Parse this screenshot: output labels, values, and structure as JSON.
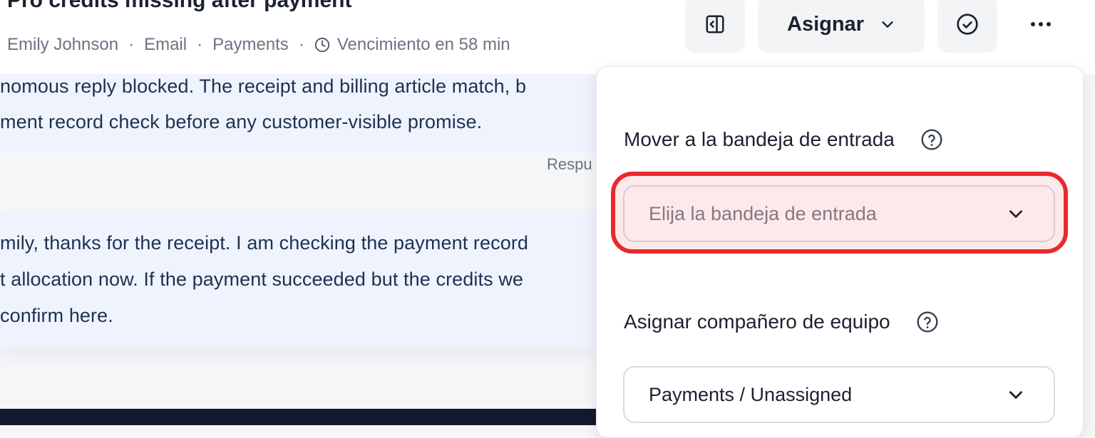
{
  "ticket": {
    "title": "Pro credits missing after payment",
    "customer": "Emily Johnson",
    "channel": "Email",
    "team": "Payments",
    "due": "Vencimiento en 58 min"
  },
  "toolbar": {
    "assign_label": "Asignar"
  },
  "thread": {
    "note_line1": "nomous reply blocked. The receipt and billing article match, b",
    "note_line2": "ment record check before any customer-visible promise.",
    "respu_label": "Respu",
    "reply_line1": "mily, thanks for the receipt. I am checking the payment record",
    "reply_line2": "t allocation now. If the payment succeeded but the credits we",
    "reply_line3": "confirm here."
  },
  "assign_panel": {
    "inbox_label": "Mover a la bandeja de entrada",
    "inbox_placeholder": "Elija la bandeja de entrada",
    "teammate_label": "Asignar compañero de equipo",
    "teammate_value": "Payments / Unassigned"
  },
  "colors": {
    "highlight": "#e8292e",
    "note_bg": "#eef3fe",
    "footer_dark": "#141a2e"
  },
  "icons": [
    "panel-toggle-icon",
    "chevron-down-icon",
    "check-circle-icon",
    "more-icon",
    "clock-icon",
    "help-icon"
  ]
}
